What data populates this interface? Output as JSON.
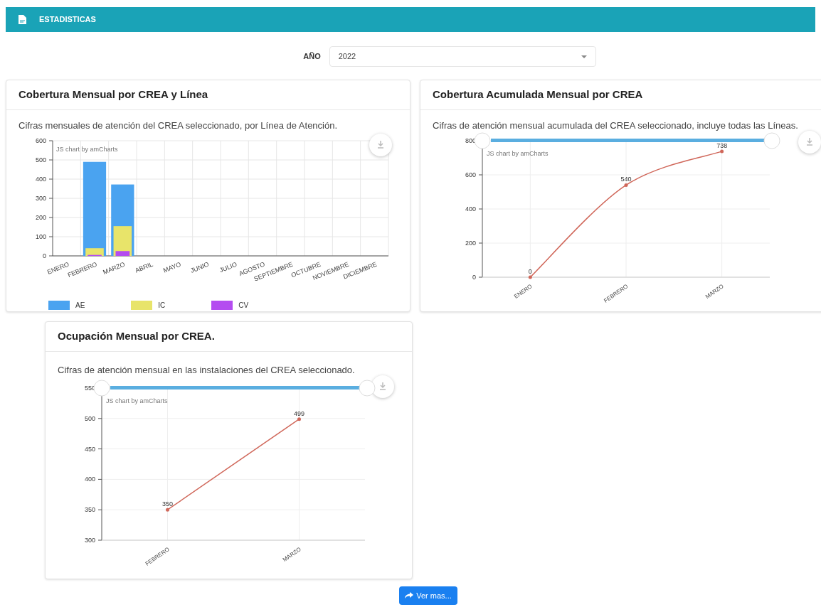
{
  "header": {
    "title": "ESTADISTICAS"
  },
  "year_filter": {
    "label": "AÑO",
    "value": "2022"
  },
  "cards": [
    {
      "title": "Cobertura Mensual por CREA y Línea",
      "description": "Cifras mensuales de atención del CREA seleccionado, por Línea de Atención.",
      "credit": "JS chart by amCharts",
      "chart_data": {
        "type": "bar",
        "stacked": false,
        "grid": true,
        "categories": [
          "ENERO",
          "FEBRERO",
          "MARZO",
          "ABRIL",
          "MAYO",
          "JUNIO",
          "JULIO",
          "AGOSTO",
          "SEPTIEMBRE",
          "OCTUBRE",
          "NOVIEMBRE",
          "DICIEMBRE"
        ],
        "ylim": [
          0,
          600
        ],
        "yticks": [
          0,
          100,
          200,
          300,
          400,
          500,
          600
        ],
        "series": [
          {
            "name": "AE",
            "color": "#4aa3f0",
            "values": [
              null,
              490,
              372,
              null,
              null,
              null,
              null,
              null,
              null,
              null,
              null,
              null
            ]
          },
          {
            "name": "IC",
            "color": "#e8e46a",
            "values": [
              null,
              40,
              155,
              null,
              null,
              null,
              null,
              null,
              null,
              null,
              null,
              null
            ]
          },
          {
            "name": "CV",
            "color": "#b44cf0",
            "values": [
              null,
              5,
              25,
              null,
              null,
              null,
              null,
              null,
              null,
              null,
              null,
              null
            ]
          }
        ]
      }
    },
    {
      "title": "Cobertura Acumulada Mensual por CREA",
      "description": "Cifras de atención mensual acumulada del CREA seleccionado, incluye todas las Líneas.",
      "credit": "JS chart by amCharts",
      "chart_data": {
        "type": "line",
        "grid": true,
        "data_labels": true,
        "categories": [
          "ENERO",
          "FEBRERO",
          "MARZO"
        ],
        "ylim": [
          0,
          800
        ],
        "yticks": [
          0,
          200,
          400,
          600,
          800
        ],
        "series": [
          {
            "color": "#d0675a",
            "values": [
              0,
              540,
              738
            ]
          }
        ]
      }
    },
    {
      "title": "Ocupación Mensual por CREA.",
      "description": "Cifras de atención mensual en las instalaciones del CREA seleccionado.",
      "credit": "JS chart by amCharts",
      "chart_data": {
        "type": "line",
        "grid": true,
        "data_labels": true,
        "categories": [
          "FEBRERO",
          "MARZO"
        ],
        "ylim": [
          300,
          550
        ],
        "yticks": [
          300,
          350,
          400,
          450,
          500,
          550
        ],
        "series": [
          {
            "color": "#d0675a",
            "values": [
              350,
              499
            ]
          }
        ]
      }
    }
  ],
  "button": {
    "label": "Ver mas..."
  }
}
